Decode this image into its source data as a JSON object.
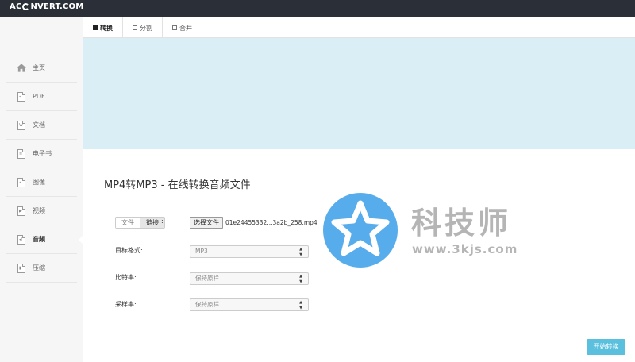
{
  "app": {
    "logo_left": "AC",
    "logo_right": "NVERT.COM"
  },
  "sidebar": {
    "items": [
      {
        "label": "主页",
        "icon": "home-icon"
      },
      {
        "label": "PDF",
        "icon": "pdf-file-icon"
      },
      {
        "label": "文档",
        "icon": "word-file-icon"
      },
      {
        "label": "电子书",
        "icon": "ebook-icon"
      },
      {
        "label": "图像",
        "icon": "image-file-icon"
      },
      {
        "label": "视频",
        "icon": "video-file-icon"
      },
      {
        "label": "音频",
        "icon": "audio-file-icon",
        "active": true
      },
      {
        "label": "压缩",
        "icon": "archive-file-icon"
      }
    ]
  },
  "tabs": [
    {
      "label": "转换",
      "active": true
    },
    {
      "label": "分割"
    },
    {
      "label": "合并"
    }
  ],
  "main": {
    "title": "MP4转MP3 - 在线转换音频文件",
    "source_toggle": {
      "file": "文件",
      "link": "链接"
    },
    "source_colon": ":",
    "choose_file_label": "选择文件",
    "file_name": "01e24455332...3a2b_258.mp4",
    "fields": [
      {
        "label": "目标格式:",
        "value": "MP3"
      },
      {
        "label": "比特率:",
        "value": "保持原样"
      },
      {
        "label": "采样率:",
        "value": "保持原样"
      }
    ],
    "start_button": "开始转换"
  },
  "watermark": {
    "text": "科技师",
    "url": "www.3kjs.com"
  },
  "colors": {
    "topbar": "#2b3038",
    "banner": "#daeef6",
    "accent": "#5bc0de",
    "watermark_blue": "#3a9ee8"
  }
}
